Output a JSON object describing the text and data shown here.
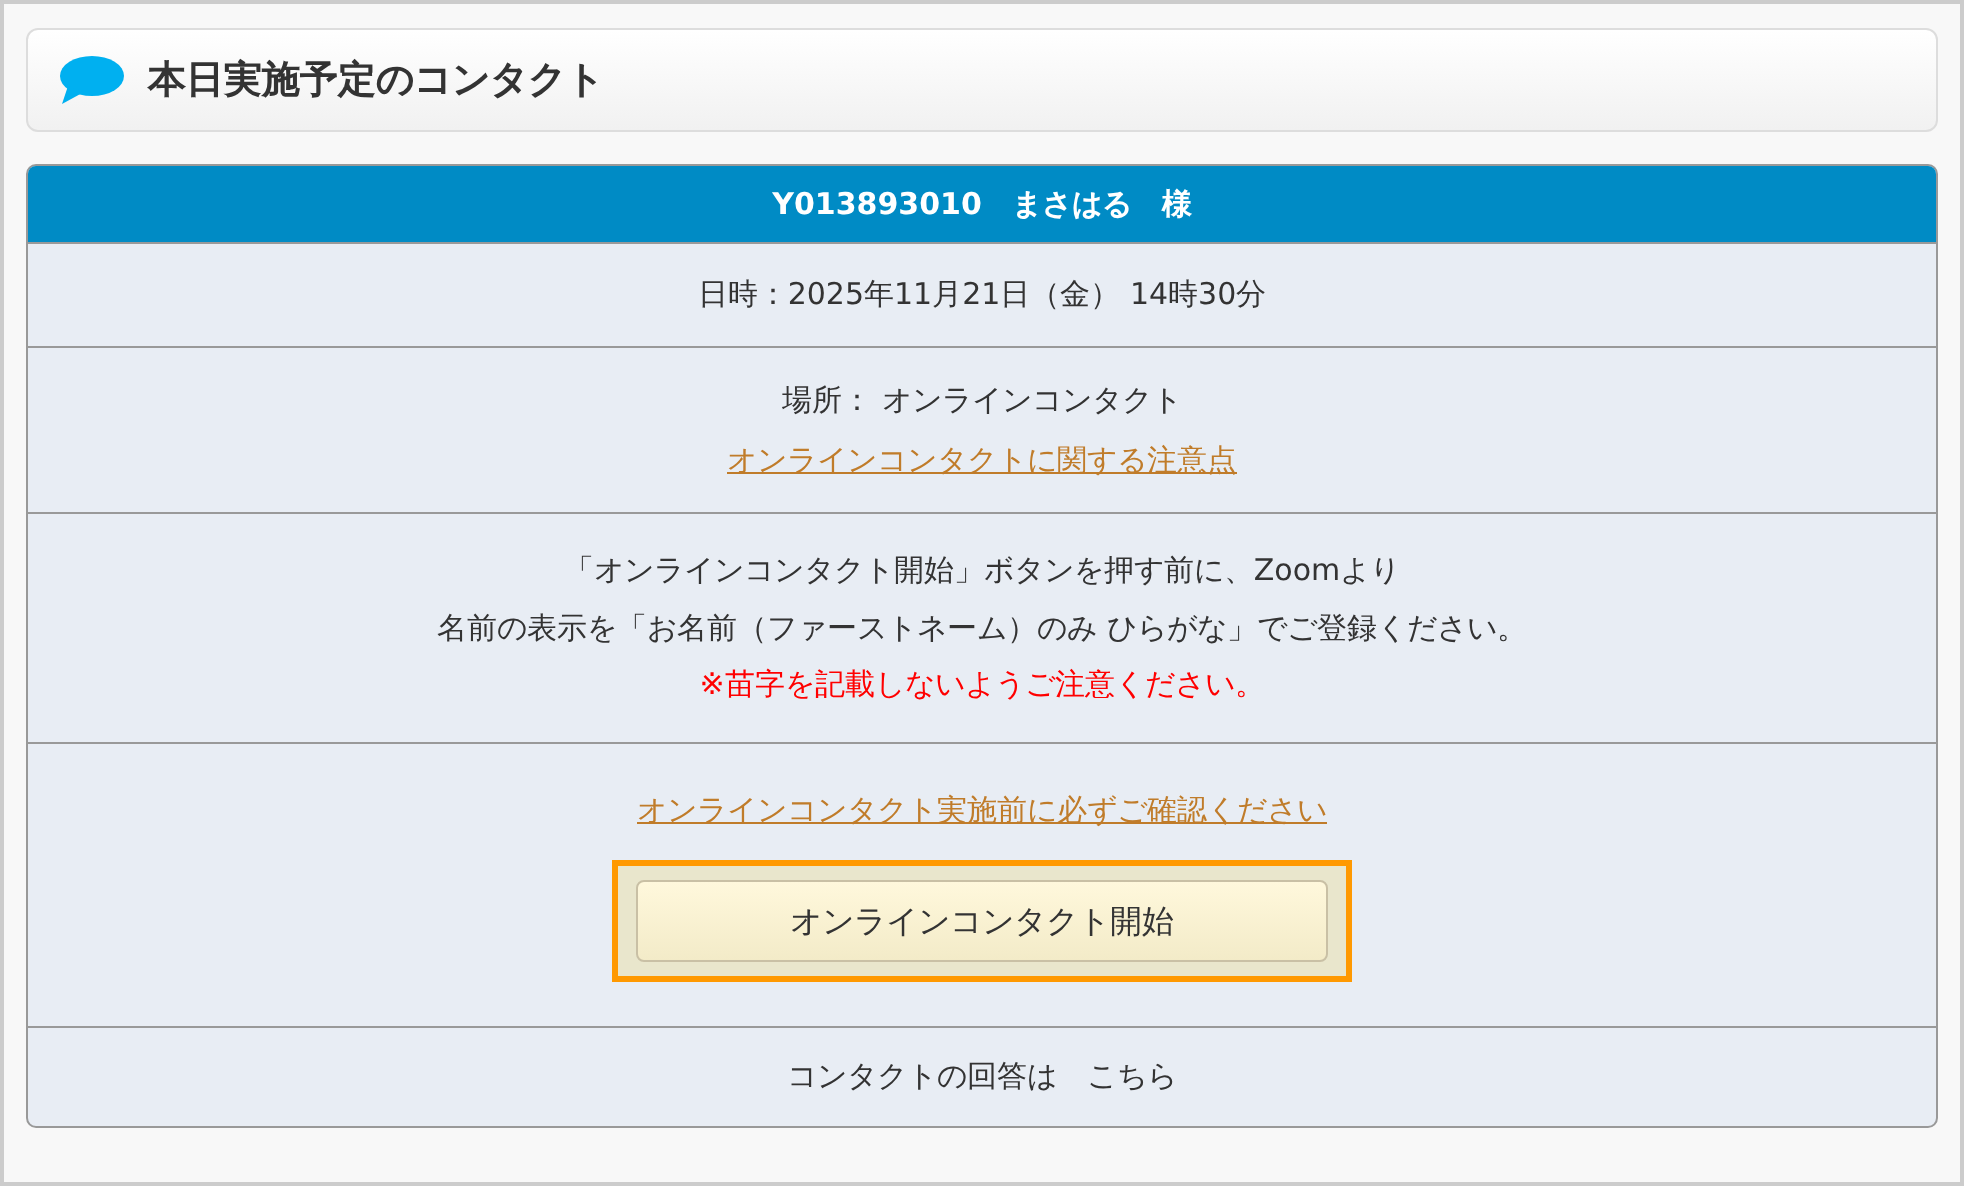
{
  "header": {
    "title": "本日実施予定のコンタクト"
  },
  "card": {
    "title": "Y013893010　まさはる　様",
    "datetime": "日時：2025年11月21日（金） 14時30分",
    "place": "場所： オンラインコンタクト",
    "place_link": "オンラインコンタクトに関する注意点",
    "notice_lines": [
      "「オンラインコンタクト開始」ボタンを押す前に、Zoomより",
      "名前の表示を「お名前（ファーストネーム）のみ ひらがな」でご登録ください。"
    ],
    "warning": "※苗字を記載しないようご注意ください。",
    "confirm_link": "オンラインコンタクト実施前に必ずご確認ください",
    "start_button": {
      "label": "オンラインコンタクト開始",
      "highlighted": true
    },
    "answer": "コンタクトの回答は　こちら"
  }
}
